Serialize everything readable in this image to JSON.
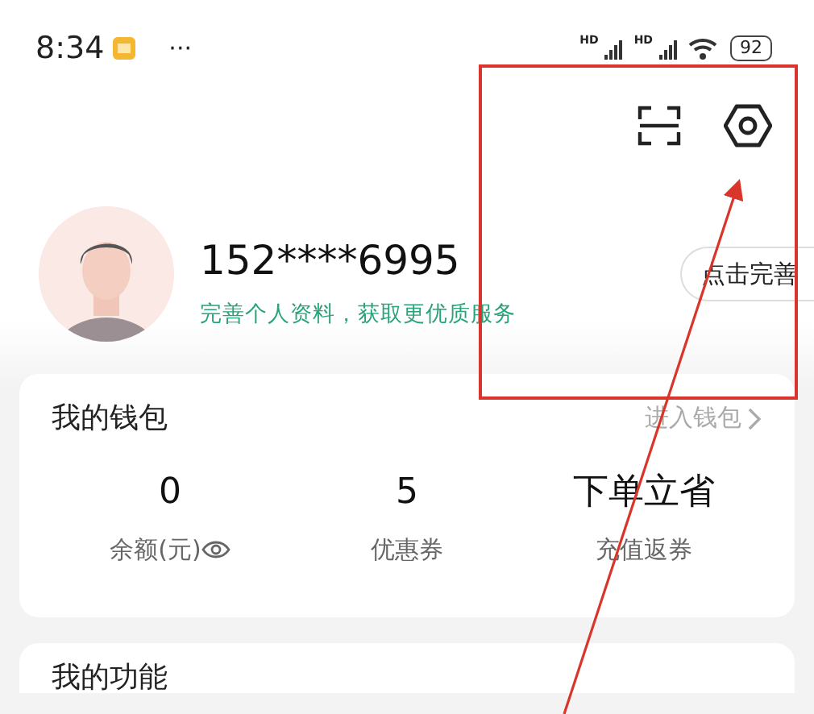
{
  "status_bar": {
    "time": "8:34",
    "more": "···",
    "signal_labels": [
      "HD",
      "HD"
    ],
    "battery": "92"
  },
  "profile": {
    "phone": "152****6995",
    "subtitle": "完善个人资料，获取更优质服务",
    "button": "点击完善"
  },
  "wallet": {
    "title": "我的钱包",
    "link": "进入钱包",
    "stats": [
      {
        "value": "0",
        "label": "余额(元)",
        "kind": "balance"
      },
      {
        "value": "5",
        "label": "优惠券",
        "kind": "plain"
      },
      {
        "value": "下单立省",
        "label": "充值返券",
        "kind": "plain"
      }
    ]
  },
  "functions": {
    "title": "我的功能"
  }
}
